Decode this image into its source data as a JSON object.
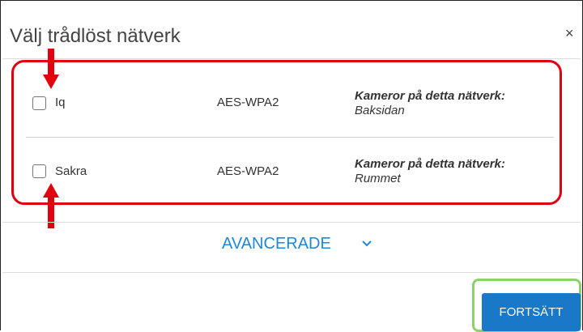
{
  "dialog": {
    "title": "Välj trådlöst nätverk",
    "close_symbol": "×"
  },
  "networks": [
    {
      "name": "Iq",
      "security": "AES-WPA2",
      "cameras_label": "Kameror på detta nätverk:",
      "cameras": "Baksidan",
      "checked": false
    },
    {
      "name": "Sakra",
      "security": "AES-WPA2",
      "cameras_label": "Kameror på detta nätverk:",
      "cameras": "Rummet",
      "checked": false
    }
  ],
  "advanced": {
    "label": "AVANCERADE",
    "chevron": "﹀"
  },
  "footer": {
    "continue_label": "FORTSÄTT"
  },
  "colors": {
    "accent": "#1e88d6",
    "button": "#1a78c9",
    "highlight_red": "#e00010",
    "highlight_green": "#8ed16b"
  }
}
